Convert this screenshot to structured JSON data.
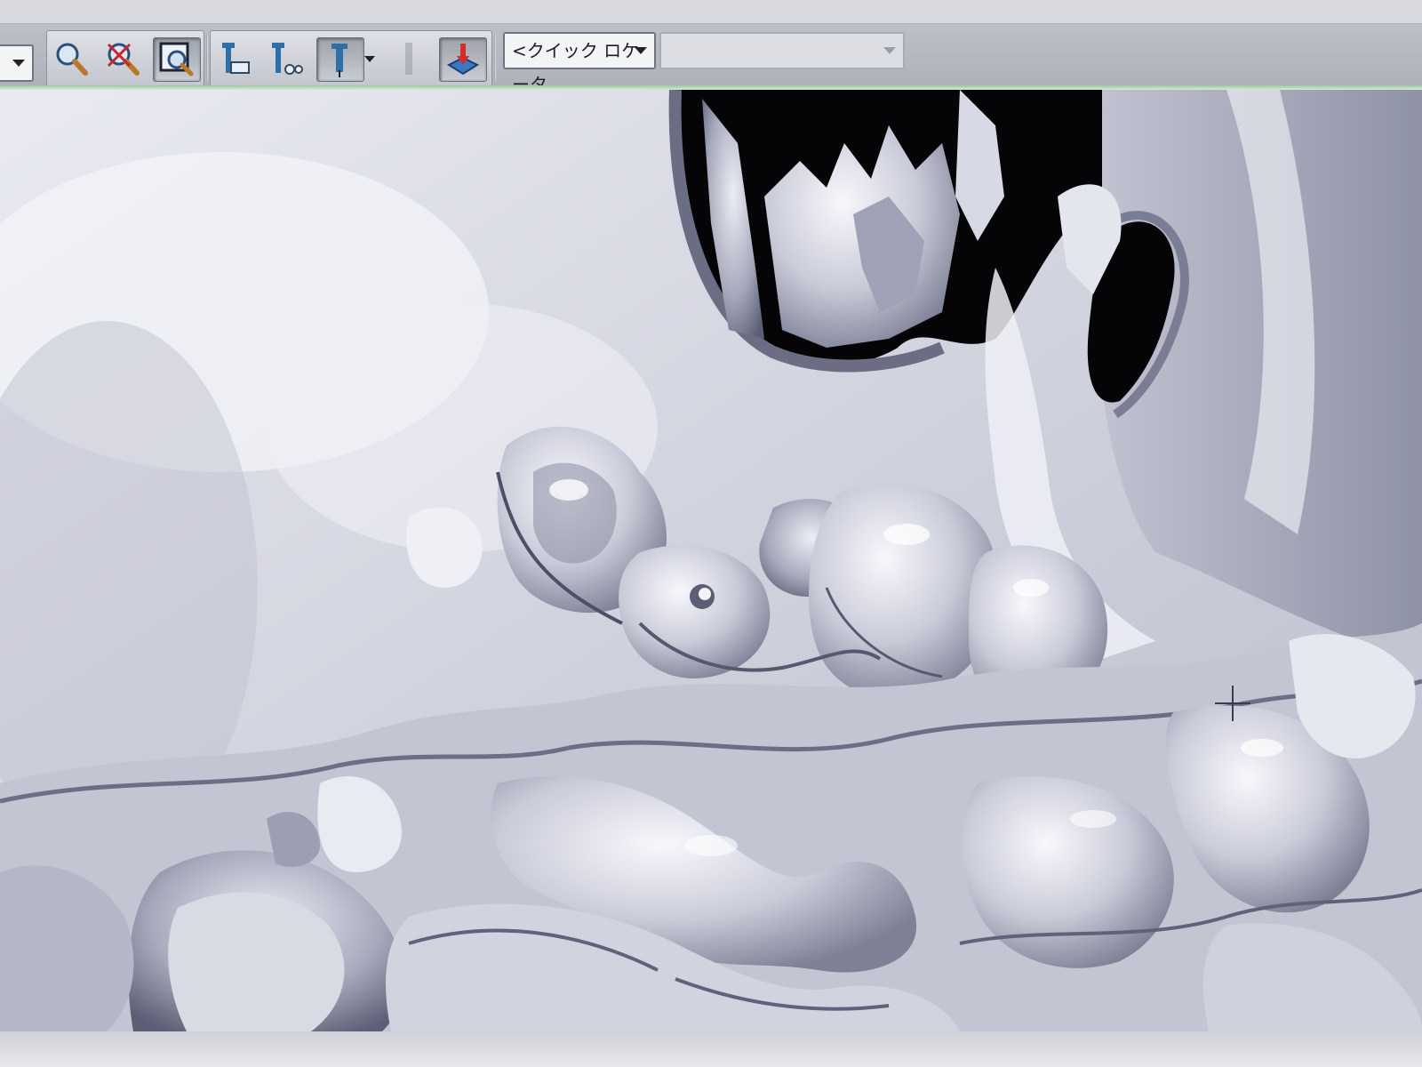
{
  "toolbar": {
    "quick_locator": {
      "value": "<クイック ロケータ",
      "icon": "chevron-down-icon"
    },
    "secondary_select": {
      "value": "",
      "icon": "chevron-down-icon"
    },
    "buttons": [
      {
        "icon": "zoom-in-icon"
      },
      {
        "icon": "zoom-out-icon"
      },
      {
        "icon": "zoom-window-icon"
      },
      {
        "icon": "tool-a-icon"
      },
      {
        "icon": "tool-b-icon"
      },
      {
        "icon": "tool-c-icon"
      },
      {
        "icon": "tool-d-icon"
      },
      {
        "icon": "orient-icon"
      }
    ]
  },
  "viewport": {
    "content": "3d-rendered-surface",
    "cursor": "crosshair-icon",
    "colors": {
      "surface_light": "#f2f3f8",
      "surface_mid": "#b7b9c9",
      "surface_dark": "#5b5e74",
      "cavity": "#050508"
    }
  },
  "colors": {
    "toolbar_bg": "#bcc0c7",
    "accent_line": "#9fc7a0",
    "pressed_button": "#9da2ab"
  }
}
